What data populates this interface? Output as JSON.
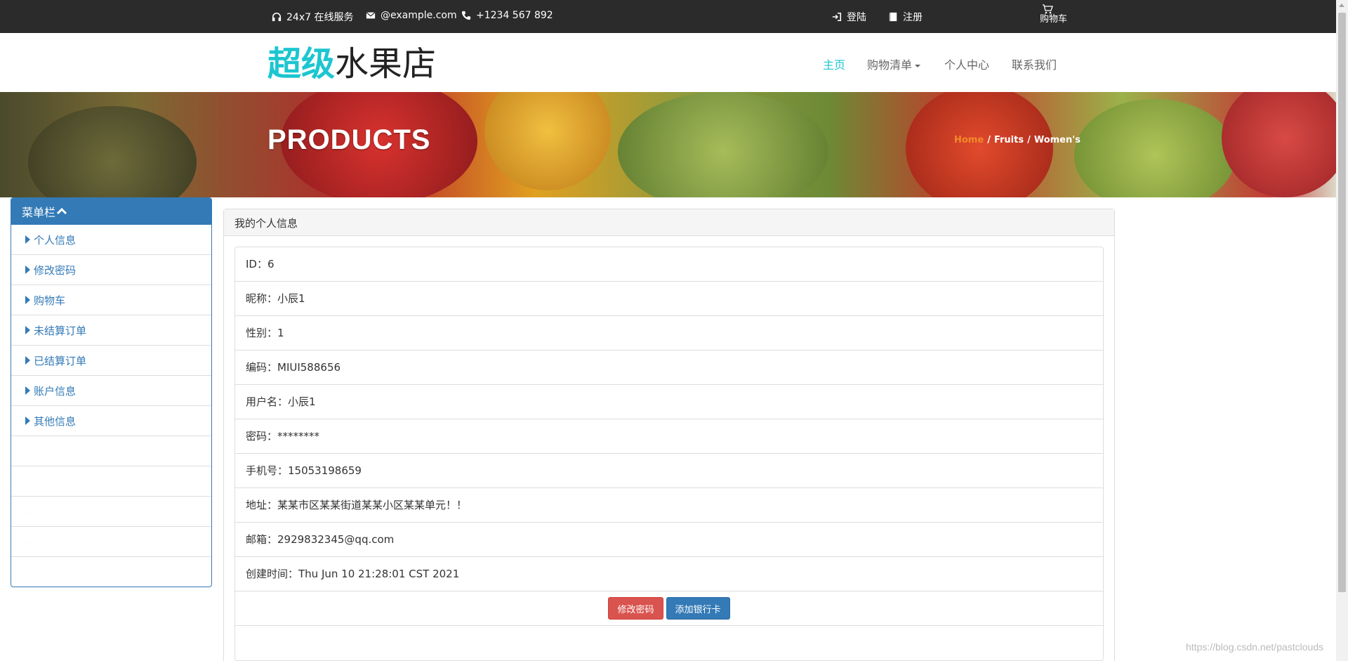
{
  "topbar": {
    "service": "24x7 在线服务",
    "email": "@example.com",
    "phone": "+1234 567 892",
    "login": "登陆",
    "register": "注册",
    "cart": "购物车"
  },
  "header": {
    "logo_highlight": "超级",
    "logo_rest": "水果店",
    "nav": {
      "home": "主页",
      "shopping_list": "购物清单",
      "personal_center": "个人中心",
      "contact": "联系我们"
    }
  },
  "banner": {
    "title": "PRODUCTS",
    "breadcrumb": [
      "Home",
      "Fruits",
      "Women's"
    ],
    "separator": "/"
  },
  "sidebar": {
    "title": "菜单栏",
    "items": [
      "个人信息",
      "修改密码",
      "购物车",
      "未结算订单",
      "已结算订单",
      "账户信息",
      "其他信息"
    ],
    "empty_items": [
      ".",
      ".",
      ".",
      ".",
      "."
    ]
  },
  "panel": {
    "title": "我的个人信息",
    "fields": [
      "ID：6",
      "昵称：小辰1",
      "性别：1",
      "编码：MIUI588656",
      "用户名：小辰1",
      "密码：********",
      "手机号：15053198659",
      "地址：某某市区某某街道某某小区某某单元！！",
      "邮箱：2929832345@qq.com",
      "创建时间：Thu Jun 10 21:28:01 CST 2021"
    ],
    "buttons": {
      "change_password": "修改密码",
      "add_bank_card": "添加银行卡"
    }
  },
  "watermark": "https://blog.csdn.net/pastclouds",
  "colors": {
    "accent": "#1cc6d0",
    "primary": "#337ab7",
    "danger": "#d9534f",
    "topbar": "#2b2b2b",
    "breadcrumb_home": "#f28a2a"
  }
}
